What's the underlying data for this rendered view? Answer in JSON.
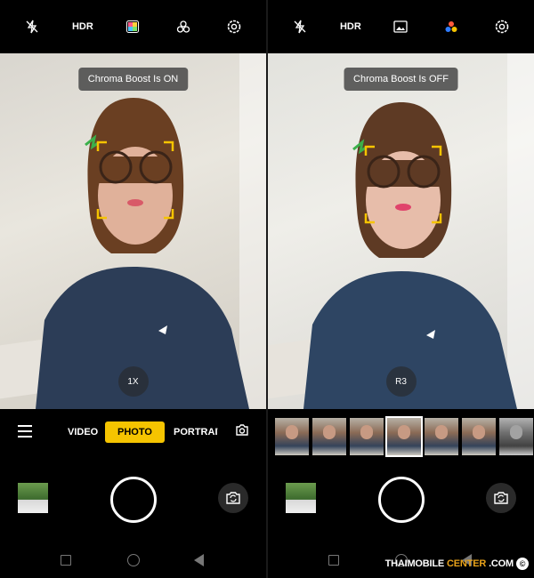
{
  "left": {
    "topbar": {
      "hdr_label": "HDR",
      "icons": [
        "flash-off-icon",
        "hdr-icon",
        "color-palette-icon",
        "filter-icon",
        "settings-icon"
      ]
    },
    "toast": "Chroma Boost Is ON",
    "zoom": "1X",
    "modes": [
      "VIDEO",
      "PHOTO",
      "PORTRAIT"
    ],
    "active_mode": "PHOTO"
  },
  "right": {
    "topbar": {
      "hdr_label": "HDR",
      "icons": [
        "flash-off-icon",
        "hdr-icon",
        "image-icon",
        "filter-color-icon",
        "settings-icon"
      ]
    },
    "toast": "Chroma Boost Is OFF",
    "filter_label": "R3",
    "filter_count": 8,
    "selected_filter_index": 3
  },
  "watermark": {
    "part1": "THAIMOBILE",
    "part2": "CENTER",
    "part3": ".COM"
  },
  "colors": {
    "accent": "#f5c400",
    "focus_frame": "#f5c400",
    "background": "#000000"
  }
}
